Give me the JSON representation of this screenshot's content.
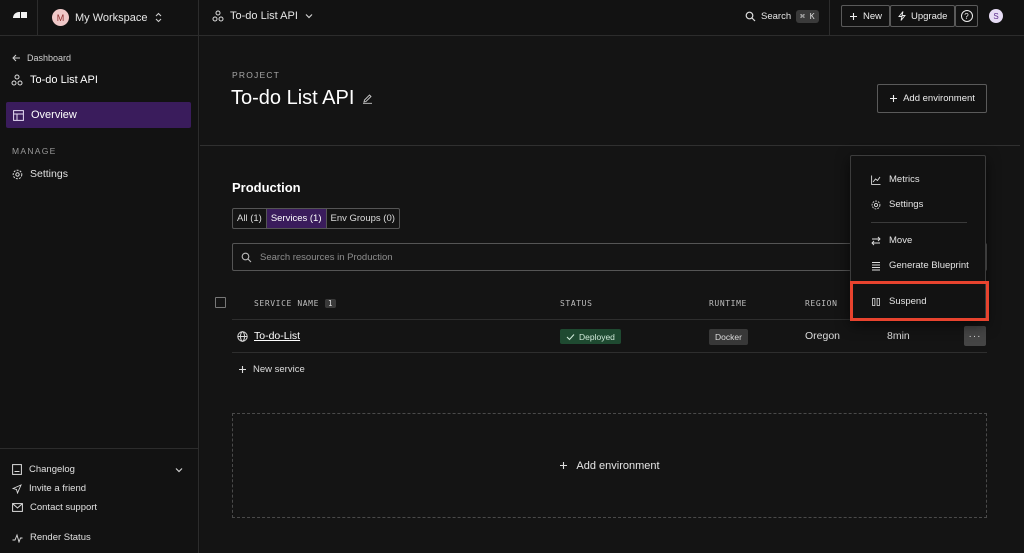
{
  "topbar": {
    "workspace_initial": "M",
    "workspace_name": "My Workspace",
    "project_name": "To-do List API",
    "search_label": "Search",
    "search_shortcut": "⌘ K",
    "new_label": "New",
    "upgrade_label": "Upgrade",
    "help_label": "?",
    "user_initial": "S"
  },
  "sidebar": {
    "back_label": "Dashboard",
    "project_name": "To-do List API",
    "overview_label": "Overview",
    "manage_section": "MANAGE",
    "settings_label": "Settings",
    "changelog_label": "Changelog",
    "invite_label": "Invite a friend",
    "support_label": "Contact support",
    "status_label": "Render Status"
  },
  "header": {
    "eyebrow": "PROJECT",
    "title": "To-do List API",
    "add_env_label": "Add environment"
  },
  "environment": {
    "name": "Production",
    "tabs": [
      {
        "label": "All (1)",
        "active": false
      },
      {
        "label": "Services (1)",
        "active": true
      },
      {
        "label": "Env Groups (0)",
        "active": false
      }
    ],
    "search_placeholder": "Search resources in Production",
    "columns": {
      "service_name": "SERVICE NAME",
      "service_count": "1",
      "status": "STATUS",
      "runtime": "RUNTIME",
      "region": "REGION"
    },
    "rows": [
      {
        "name": "To-do-List",
        "status": "Deployed",
        "runtime": "Docker",
        "region": "Oregon",
        "updated": "8min"
      }
    ],
    "new_service_label": "New service",
    "more_label": "···"
  },
  "add_environment_block": {
    "label": "Add environment"
  },
  "context_menu": {
    "items": [
      "Metrics",
      "Settings",
      "Move",
      "Generate Blueprint",
      "Suspend"
    ]
  },
  "colors": {
    "accent_purple": "#3a1c5c",
    "deployed_green": "#1f4a31",
    "highlight_red": "#e8432e"
  }
}
